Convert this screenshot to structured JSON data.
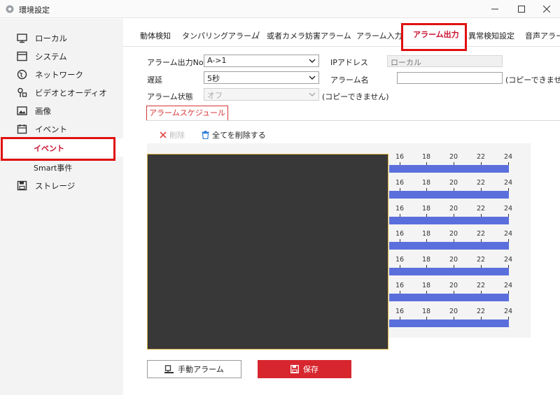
{
  "window": {
    "title": "環境設定"
  },
  "sidebar": {
    "items": [
      {
        "label": "ローカル",
        "icon": "monitor-icon"
      },
      {
        "label": "システム",
        "icon": "system-icon"
      },
      {
        "label": "ネットワーク",
        "icon": "globe-icon"
      },
      {
        "label": "ビデオとオーディオ",
        "icon": "video-audio-icon"
      },
      {
        "label": "画像",
        "icon": "image-icon"
      },
      {
        "label": "イベント",
        "icon": "calendar-icon"
      }
    ],
    "subitems": [
      {
        "label": "イベント",
        "selected": true
      },
      {
        "label": "Smart事件",
        "selected": false
      }
    ],
    "storage": {
      "label": "ストレージ",
      "icon": "save-icon"
    }
  },
  "tabs": [
    {
      "label": "動体検知"
    },
    {
      "label": "タンパリングアラーム"
    },
    {
      "label": "/"
    },
    {
      "label": "或者カメラ妨害アラーム"
    },
    {
      "label": "アラーム入力"
    },
    {
      "label": "アラーム出力",
      "active": true
    },
    {
      "label": "異常検知設定"
    },
    {
      "label": "音声アラーム"
    }
  ],
  "form": {
    "alarm_output_no_label": "アラーム出力No.",
    "alarm_output_no_value": "A->1",
    "ip_address_label": "IPアドレス",
    "ip_address_value": "ローカル",
    "delay_label": "遅延",
    "delay_value": "5秒",
    "alarm_name_label": "アラーム名",
    "alarm_name_value": "",
    "alarm_name_note": "(コピーできません)",
    "alarm_status_label": "アラーム状態",
    "alarm_status_value": "オフ",
    "alarm_status_note": "(コピーできません)"
  },
  "schedule": {
    "title": "アラームスケジュール",
    "delete_label": "削除",
    "delete_all_label": "全てを削除する",
    "hour_ticks": [
      "16",
      "18",
      "20",
      "22",
      "24"
    ],
    "days_count": 7
  },
  "buttons": {
    "manual_alarm": "手動アラーム",
    "save": "保存"
  },
  "colors": {
    "accent_red": "#d7262e",
    "highlight_box": "#e01010",
    "schedule_bar": "#5b6fdc"
  }
}
